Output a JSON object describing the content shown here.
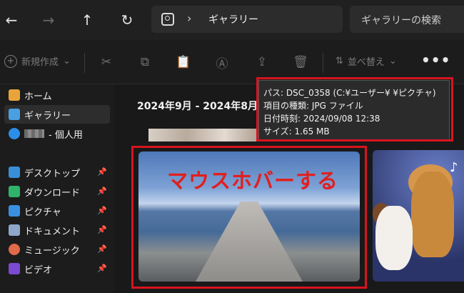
{
  "address_bar": {
    "path": [
      "ギャラリー"
    ],
    "search_placeholder": "ギャラリーの検索"
  },
  "toolbar": {
    "new_label": "新規作成",
    "sort_label": "並べ替え",
    "more_label": "•••"
  },
  "sidebar": {
    "items": [
      {
        "label": "ホーム",
        "icon": "home-icon",
        "color": "#e8a43a"
      },
      {
        "label": "ギャラリー",
        "icon": "gallery-icon",
        "color": "#4a9fe0",
        "active": true
      },
      {
        "label": "- 個人用",
        "icon": "onedrive-icon",
        "color": "#2b8fe8"
      },
      {
        "label": "デスクトップ",
        "icon": "desktop-icon",
        "color": "#3a8fd8",
        "pinned": true
      },
      {
        "label": "ダウンロード",
        "icon": "download-icon",
        "color": "#2fb36b",
        "pinned": true
      },
      {
        "label": "ピクチャ",
        "icon": "pictures-icon",
        "color": "#3a8fe0",
        "pinned": true
      },
      {
        "label": "ドキュメント",
        "icon": "documents-icon",
        "color": "#8ea7c8",
        "pinned": true
      },
      {
        "label": "ミュージック",
        "icon": "music-icon",
        "color": "#e06a4a",
        "pinned": true
      },
      {
        "label": "ビデオ",
        "icon": "video-icon",
        "color": "#7a4ad0",
        "pinned": true
      }
    ]
  },
  "main": {
    "date_heading": "2024年9月 - 2024年8月",
    "overlay_text": "マウスホバーする"
  },
  "tooltip": {
    "lines": [
      "パス: DSC_0358 (C:¥ユーザー¥        ¥ピクチャ)",
      "項目の種類: JPG ファイル",
      "日付時刻: 2024/09/08 12:38",
      "サイズ: 1.65 MB"
    ]
  },
  "colors": {
    "highlight_frame": "#d8141e",
    "overlay_text": "#e02020"
  }
}
